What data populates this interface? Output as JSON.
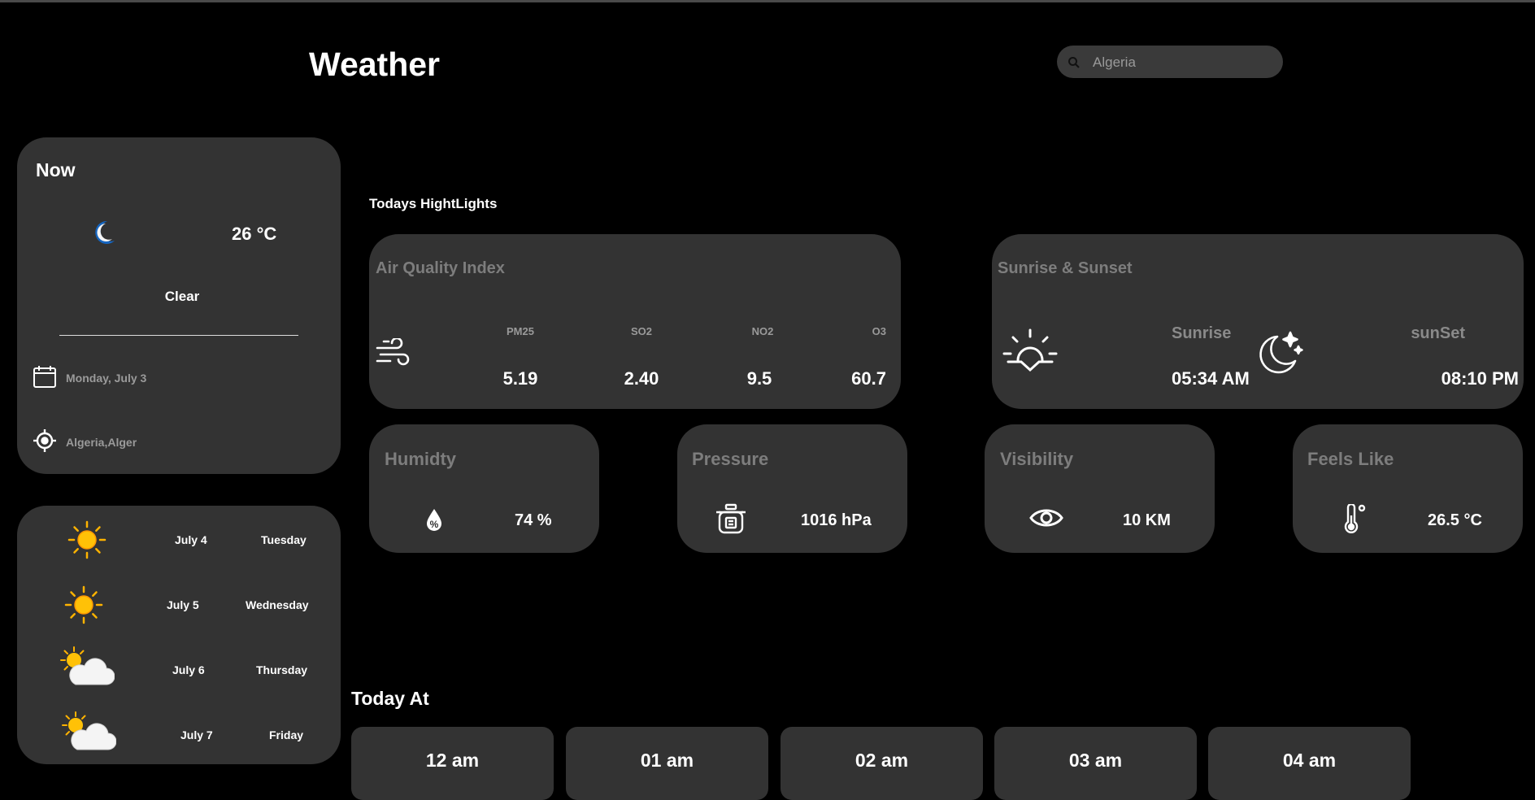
{
  "header": {
    "title": "Weather",
    "search": {
      "placeholder": "Algeria"
    }
  },
  "now": {
    "title": "Now",
    "icon": "moon-icon",
    "temperature": "26 °C",
    "condition": "Clear",
    "date": "Monday, July 3",
    "location": "Algeria,Alger"
  },
  "forecast": [
    {
      "icon": "sun-icon",
      "date": "July 4",
      "day": "Tuesday"
    },
    {
      "icon": "sun-icon",
      "date": "July 5",
      "day": "Wednesday"
    },
    {
      "icon": "partly-cloudy-icon",
      "date": "July 6",
      "day": "Thursday"
    },
    {
      "icon": "partly-cloudy-icon",
      "date": "July 7",
      "day": "Friday"
    }
  ],
  "highlights": {
    "title": "Todays HightLights",
    "air_quality": {
      "title": "Air Quality Index",
      "icon": "wind-icon",
      "items": [
        {
          "label": "PM25",
          "value": "5.19"
        },
        {
          "label": "SO2",
          "value": "2.40"
        },
        {
          "label": "NO2",
          "value": "9.5"
        },
        {
          "label": "O3",
          "value": "60.7"
        }
      ]
    },
    "sun": {
      "title": "Sunrise & Sunset",
      "sunrise_label": "Sunrise",
      "sunrise_value": "05:34 AM",
      "sunset_label": "sunSet",
      "sunset_value": "08:10 PM"
    },
    "humidity": {
      "title": "Humidty",
      "icon": "humidity-icon",
      "value": "74 %"
    },
    "pressure": {
      "title": "Pressure",
      "icon": "pressure-cooker-icon",
      "value": "1016 hPa"
    },
    "visibility": {
      "title": "Visibility",
      "icon": "eye-icon",
      "value": "10 KM"
    },
    "feels_like": {
      "title": "Feels Like",
      "icon": "thermometer-icon",
      "value": "26.5 °C"
    }
  },
  "today_at": {
    "title": "Today At",
    "hours": [
      "12 am",
      "01 am",
      "02 am",
      "03 am",
      "04 am"
    ]
  },
  "colors": {
    "background": "#000000",
    "card": "#333333",
    "accent_sun": "#FFC107"
  }
}
